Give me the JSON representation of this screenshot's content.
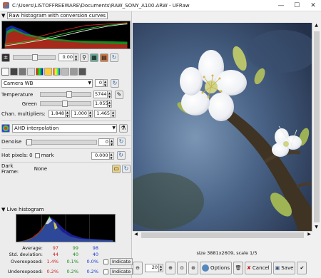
{
  "window": {
    "title": "C:\\Users\\LISTOFFREEWARE\\Documents\\RAW_SONY_A100.ARW - UFRaw",
    "minimize": "—",
    "maximize": "☐",
    "close": "✕"
  },
  "raw_hist": {
    "expander_label": "Raw histogram with conversion curves"
  },
  "exposure": {
    "value": "0.00"
  },
  "wb": {
    "preset": "Camera WB",
    "preset_fine": "0",
    "temperature_label": "Temperature",
    "temperature_value": "5744",
    "green_label": "Green",
    "green_value": "1.055",
    "chan_label": "Chan. multipliers:",
    "chan_values": [
      "1.848",
      "1.000",
      "1.465"
    ]
  },
  "interp": {
    "method": "AHD interpolation"
  },
  "denoise": {
    "label": "Denoise",
    "value": "0"
  },
  "hotpixels": {
    "label": "Hot pixels:",
    "count": "0",
    "mark_label": "mark",
    "threshold": "0.000"
  },
  "darkframe": {
    "label": "Dark Frame:",
    "value": "None"
  },
  "live_hist": {
    "expander_label": "Live histogram",
    "average_label": "Average:",
    "average": [
      "97",
      "99",
      "98"
    ],
    "stddev_label": "Std. deviation:",
    "stddev": [
      "44",
      "40",
      "40"
    ],
    "overexposed_label": "Overexposed:",
    "overexposed": [
      "1.4%",
      "0.1%",
      "0.0%"
    ],
    "underexposed_label": "Underexposed:",
    "underexposed": [
      "0.2%",
      "0.2%",
      "0.2%"
    ],
    "indicate_label": "Indicate",
    "colors": {
      "red": "#d42020",
      "green": "#1a8a1a",
      "blue": "#1a3ad4"
    }
  },
  "status": {
    "size_text": "size 3881x2609, scale 1/5"
  },
  "bottom": {
    "zoom_value": "20",
    "options_label": "Options",
    "cancel_label": "Cancel",
    "save_label": "Save"
  }
}
